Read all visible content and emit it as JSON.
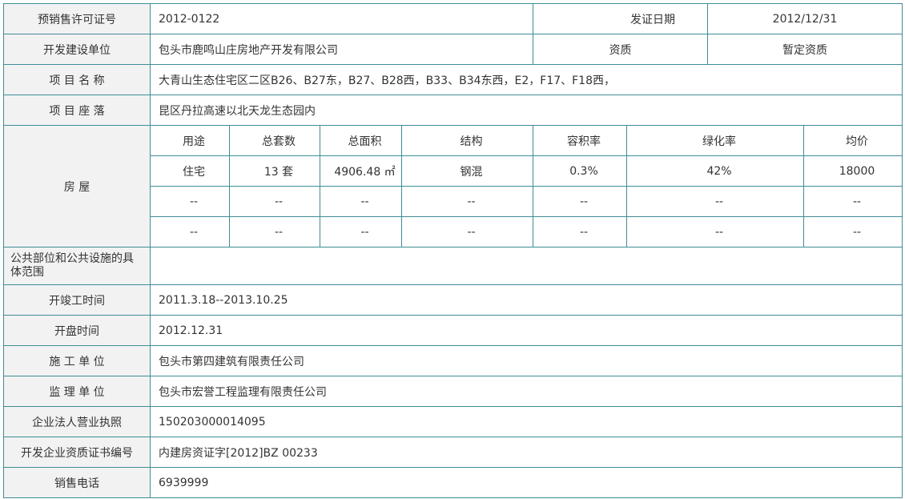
{
  "permit": {
    "label": "预销售许可证号",
    "value": "2012-0122",
    "issue_date_label": "发证日期",
    "issue_date": "2012/12/31"
  },
  "developer": {
    "label": "开发建设单位",
    "value": "包头市鹿鸣山庄房地产开发有限公司",
    "qualification_label": "资质",
    "qualification": "暂定资质"
  },
  "project_name": {
    "label": "项 目 名 称",
    "value": "大青山生态住宅区二区B26、B27东，B27、B28西，B33、B34东西，E2，F17、F18西，"
  },
  "project_location": {
    "label": "项 目 座 落",
    "value": "昆区丹拉高速以北天龙生态园内"
  },
  "housing": {
    "label": "房 屋",
    "headers": [
      "用途",
      "总套数",
      "总面积",
      "结构",
      "容积率",
      "绿化率",
      "均价"
    ],
    "rows": [
      {
        "use": "住宅",
        "units": "13 套",
        "area": "4906.48 ㎡",
        "structure": "钢混",
        "plot_ratio": "0.3%",
        "green_ratio": "42%",
        "avg_price": "18000"
      },
      {
        "use": "--",
        "units": "--",
        "area": "--",
        "structure": "--",
        "plot_ratio": "--",
        "green_ratio": "--",
        "avg_price": "--"
      },
      {
        "use": "--",
        "units": "--",
        "area": "--",
        "structure": "--",
        "plot_ratio": "--",
        "green_ratio": "--",
        "avg_price": "--"
      }
    ]
  },
  "public_facilities": {
    "label": "公共部位和公共设施的具体范围",
    "value": ""
  },
  "construction_period": {
    "label": "开竣工时间",
    "value": "2011.3.18--2013.10.25"
  },
  "opening_time": {
    "label": "开盘时间",
    "value": "2012.12.31"
  },
  "contractor": {
    "label": "施 工 单 位",
    "value": "包头市第四建筑有限责任公司"
  },
  "supervisor": {
    "label": "监 理 单 位",
    "value": "包头市宏誉工程监理有限责任公司"
  },
  "business_license": {
    "label": "企业法人营业执照",
    "value": "150203000014095"
  },
  "qualification_cert": {
    "label": "开发企业资质证书编号",
    "value": "内建房资证字[2012]BZ 00233"
  },
  "sales_phone": {
    "label": "销售电话",
    "value": "6939999"
  }
}
